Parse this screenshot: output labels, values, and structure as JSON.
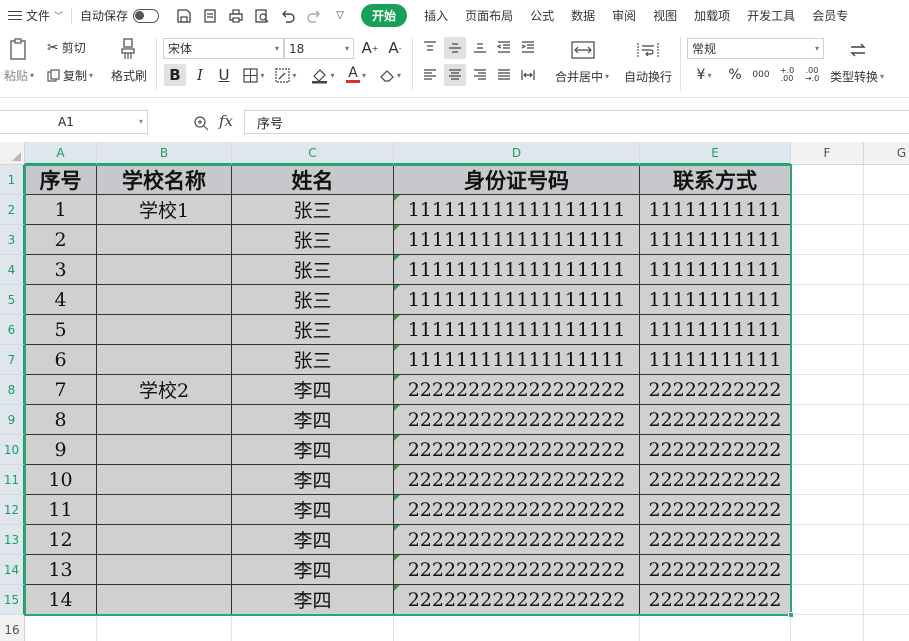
{
  "menubar": {
    "file": "文件",
    "autosave": "自动保存",
    "tabs": [
      {
        "label": "开始",
        "active": true
      },
      {
        "label": "插入"
      },
      {
        "label": "页面布局"
      },
      {
        "label": "公式"
      },
      {
        "label": "数据"
      },
      {
        "label": "审阅"
      },
      {
        "label": "视图"
      },
      {
        "label": "加载项"
      },
      {
        "label": "开发工具"
      },
      {
        "label": "会员专"
      }
    ]
  },
  "ribbon": {
    "paste": "粘贴",
    "cut": "剪切",
    "copy": "复制",
    "format_painter": "格式刷",
    "font_name": "宋体",
    "font_size": "18",
    "bold": "B",
    "italic": "I",
    "underline": "U",
    "merge_center": "合并居中",
    "wrap_text": "自动换行",
    "number_format": "常规",
    "currency": "¥",
    "percent": "%",
    "thousands": "000",
    "decimal_increase": "+.0 .00",
    "decimal_decrease": ".00 →.0",
    "type_convert": "类型转换",
    "accent_color": "#18a058",
    "font_color": "#d9342b"
  },
  "formula": {
    "cell_ref": "A1",
    "fx": "fx",
    "content": "序号"
  },
  "sheet": {
    "columns": [
      "A",
      "B",
      "C",
      "D",
      "E",
      "F",
      "G"
    ],
    "rows": [
      "1",
      "2",
      "3",
      "4",
      "5",
      "6",
      "7",
      "8",
      "9",
      "10",
      "11",
      "12",
      "13",
      "14",
      "15",
      "16"
    ],
    "header": [
      "序号",
      "学校名称",
      "姓名",
      "身份证号码",
      "联系方式"
    ],
    "data": [
      [
        "1",
        "学校1",
        "张三",
        "111111111111111111",
        "11111111111"
      ],
      [
        "2",
        "",
        "张三",
        "111111111111111111",
        "11111111111"
      ],
      [
        "3",
        "",
        "张三",
        "111111111111111111",
        "11111111111"
      ],
      [
        "4",
        "",
        "张三",
        "111111111111111111",
        "11111111111"
      ],
      [
        "5",
        "",
        "张三",
        "111111111111111111",
        "11111111111"
      ],
      [
        "6",
        "",
        "张三",
        "111111111111111111",
        "11111111111"
      ],
      [
        "7",
        "学校2",
        "李四",
        "222222222222222222",
        "22222222222"
      ],
      [
        "8",
        "",
        "李四",
        "222222222222222222",
        "22222222222"
      ],
      [
        "9",
        "",
        "李四",
        "222222222222222222",
        "22222222222"
      ],
      [
        "10",
        "",
        "李四",
        "222222222222222222",
        "22222222222"
      ],
      [
        "11",
        "",
        "李四",
        "222222222222222222",
        "22222222222"
      ],
      [
        "12",
        "",
        "李四",
        "222222222222222222",
        "22222222222"
      ],
      [
        "13",
        "",
        "李四",
        "222222222222222222",
        "22222222222"
      ],
      [
        "14",
        "",
        "李四",
        "222222222222222222",
        "22222222222"
      ]
    ]
  }
}
